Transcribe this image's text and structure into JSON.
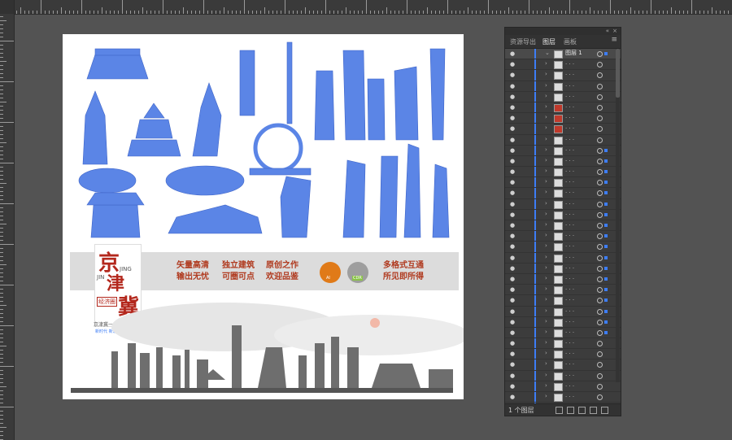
{
  "panel": {
    "tabs": [
      "资源导出",
      "图层",
      "画板"
    ],
    "layer_name": "图层 1",
    "footer_count": "1 个图层",
    "row_count": 34
  },
  "artwork": {
    "title_char_1": "京",
    "title_char_2": "津",
    "title_char_3": "冀",
    "pinyin_lines": [
      "JIN",
      "JING",
      "JI"
    ],
    "slogan_col1": "矢量高清\n输出无忧",
    "slogan_col2": "独立建筑\n可圈可点",
    "slogan_col3": "原创之作\n欢迎品鉴",
    "slogan_col4": "多格式互通\n所见即所得",
    "badge_ai": "AI",
    "badge_cdr": "CDR",
    "subtitle": "京津冀一体化",
    "subtitle_small": "新时代 新速度",
    "seal": "经济圈"
  },
  "colors": {
    "accent": "#3d7df6",
    "silhouette": "#5b85e6",
    "red": "#b3271c",
    "ai_badge": "#e07a18",
    "cdr_badge": "#8bc34a"
  }
}
